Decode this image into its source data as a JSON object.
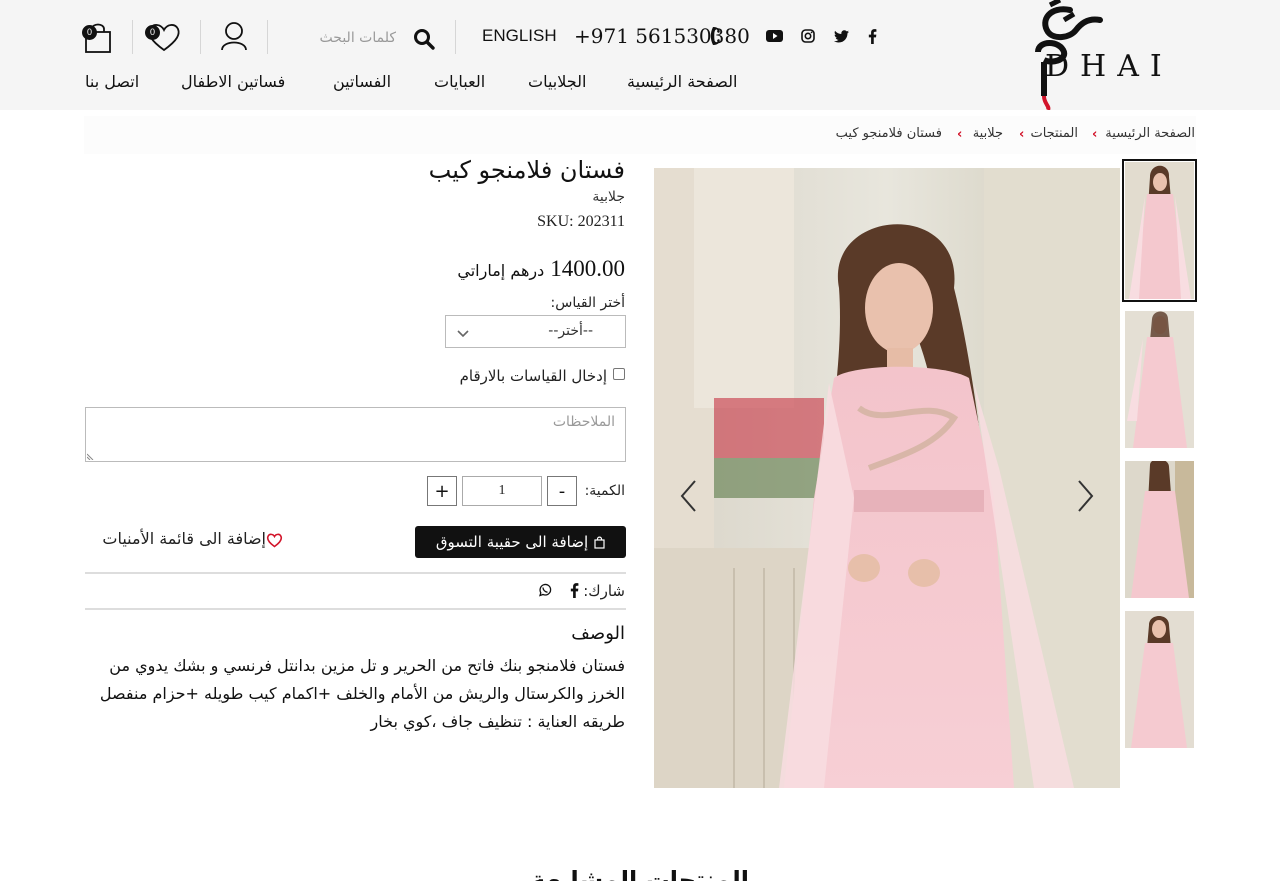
{
  "header": {
    "brand": "DHAI",
    "phone": "+971 561530380",
    "language": "ENGLISH",
    "search_placeholder": "كلمات البحث",
    "wishlist_count": "0",
    "cart_count": "0",
    "social": [
      "youtube-icon",
      "instagram-icon",
      "twitter-icon",
      "facebook-icon"
    ],
    "nav": [
      "الصفحة الرئيسية",
      "الجلابيات",
      "العبايات",
      "الفساتين",
      "فساتين الاطفال",
      "اتصل بنا"
    ]
  },
  "breadcrumb": [
    "الصفحة الرئيسية",
    "المنتجات",
    "جلابية",
    "فستان فلامنجو كيب"
  ],
  "product": {
    "title": "فستان فلامنجو كيب",
    "category": "جلابية",
    "sku": "SKU: 202311",
    "price": "1400.00",
    "currency": "درهم إماراتي",
    "size_label": "أختر القياس:",
    "size_value": "--أختر--",
    "custom_size_label": "إدخال القياسات بالارقام",
    "notes_placeholder": "الملاحظات",
    "qty_label": "الكمية:",
    "qty_value": "1",
    "qty_minus": "-",
    "qty_plus": "+",
    "add_to_cart": "إضافة الى حقيبة التسوق",
    "add_to_wishlist": "إضافة الى قائمة الأمنيات",
    "share_label": "شارك:",
    "description_title": "الوصف",
    "description_lines": [
      "فستان فلامنجو بنك فاتح من الحرير و تل مزين بدانتل فرنسي و بشك يدوي من",
      "الخرز والكرستال والريش من الأمام والخلف +اكمام كيب طويله +حزام منفصل",
      "طريقه العناية : تنظيف جاف ،كوي بخار"
    ]
  },
  "colors": {
    "accent": "#d2142a",
    "dark": "#111111",
    "header_bg": "#f5f5f5",
    "dress_pink": "#f4c6cc"
  },
  "related_heading": "المنتجات المشابهة"
}
